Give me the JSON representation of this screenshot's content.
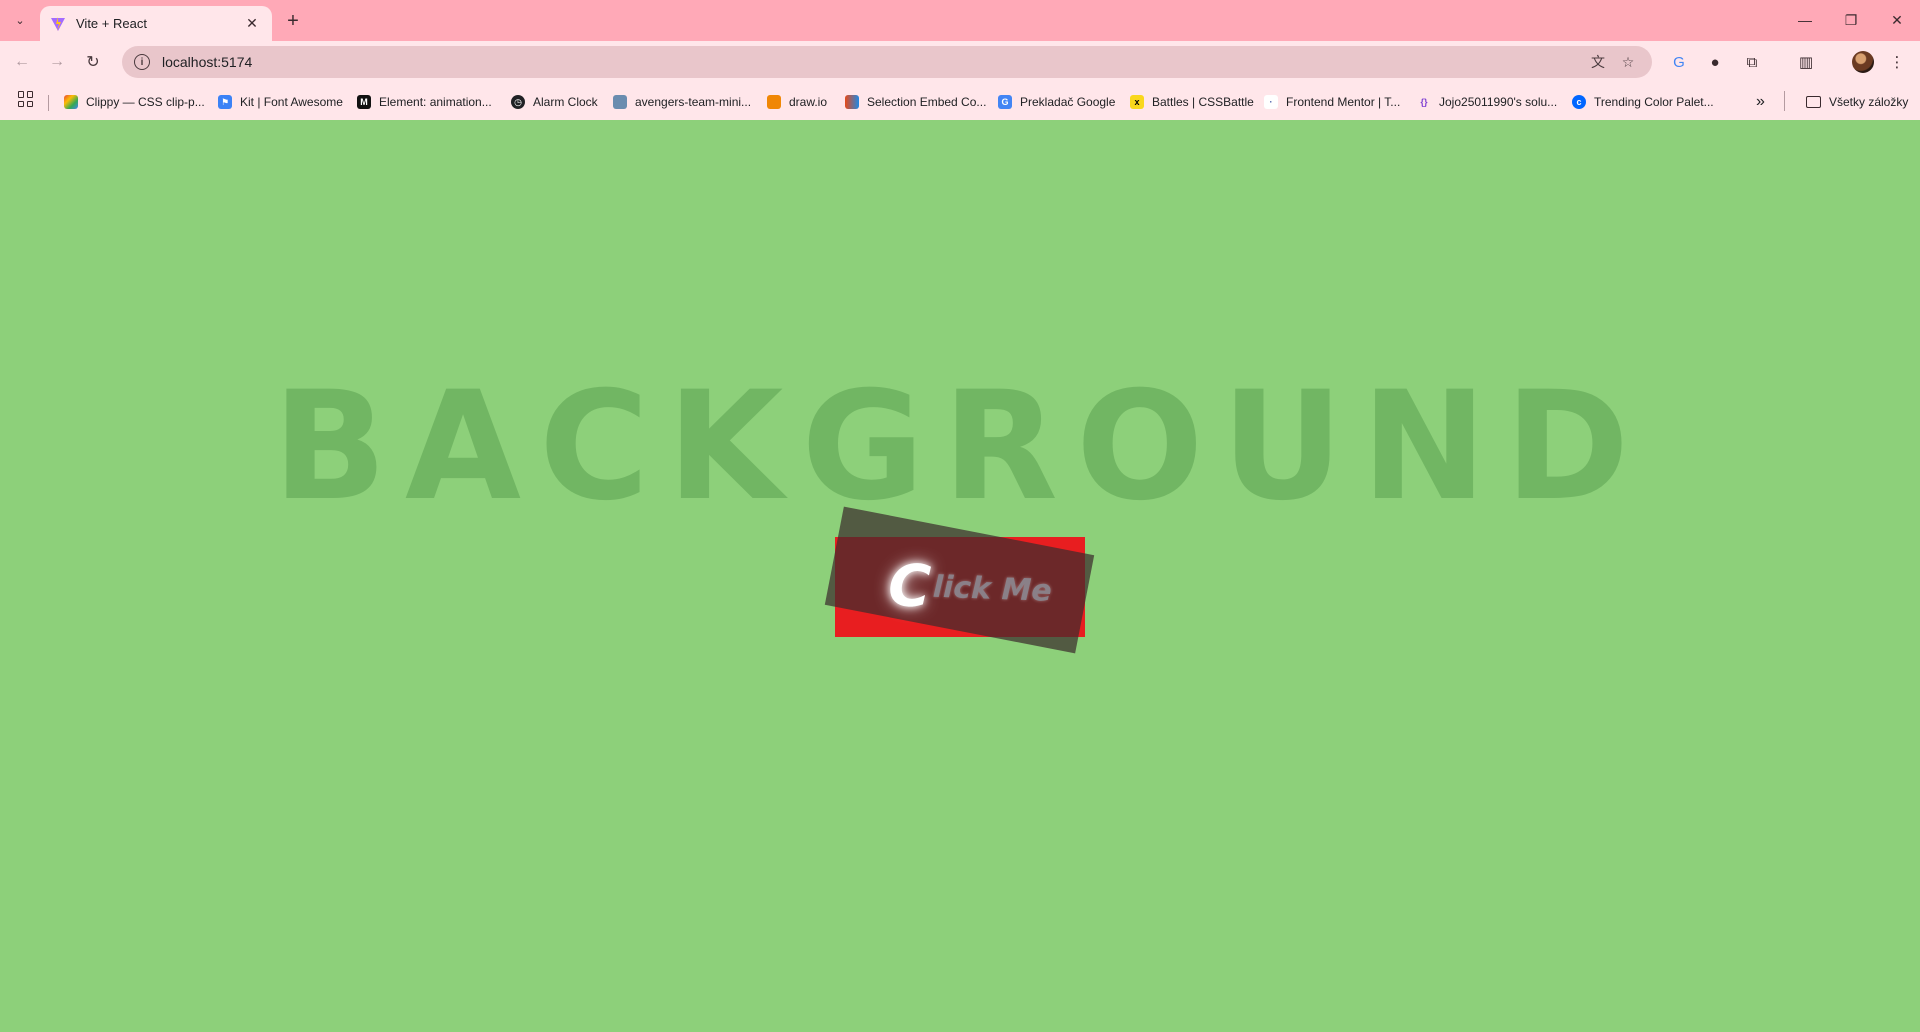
{
  "browser": {
    "tab": {
      "title": "Vite + React"
    },
    "address": "localhost:5174",
    "bookmarks": [
      {
        "label": "Clippy — CSS clip-p...",
        "icon": "clippy-icon",
        "color": "#4285f4"
      },
      {
        "label": "Kit | Font Awesome",
        "icon": "font-awesome-flag-icon",
        "color": "#3b82f6"
      },
      {
        "label": "Element: animation...",
        "icon": "mdn-icon",
        "color": "#111111"
      },
      {
        "label": "Alarm Clock",
        "icon": "alarm-clock-icon",
        "color": "#202124"
      },
      {
        "label": "avengers-team-mini...",
        "icon": "avengers-icon",
        "color": "#6a8caf"
      },
      {
        "label": "draw.io",
        "icon": "drawio-icon",
        "color": "#f08705"
      },
      {
        "label": "Selection Embed Co...",
        "icon": "selection-embed-icon",
        "color": "#e64a19"
      },
      {
        "label": "Prekladač Google",
        "icon": "google-translate-icon",
        "color": "#4285f4"
      },
      {
        "label": "Battles | CSSBattle",
        "icon": "cssbattle-icon",
        "color": "#f9d71c"
      },
      {
        "label": "Frontend Mentor | T...",
        "icon": "frontend-mentor-icon",
        "color": "#dddddd"
      },
      {
        "label": "Jojo25011990's solu...",
        "icon": "solution-icon",
        "color": "#7e3fd1"
      },
      {
        "label": "Trending Color Palet...",
        "icon": "coolors-icon",
        "color": "#0066ff"
      }
    ],
    "all_bookmarks_label": "Všetky záložky",
    "more_bookmarks": "»"
  },
  "page": {
    "background_word": "BACKGROUND",
    "button": {
      "first_letter": "C",
      "rest": "lick Me"
    },
    "colors": {
      "page_bg": "#8dd07a",
      "button_red": "#e81e20",
      "chrome_pink": "#ffa9b7"
    }
  }
}
